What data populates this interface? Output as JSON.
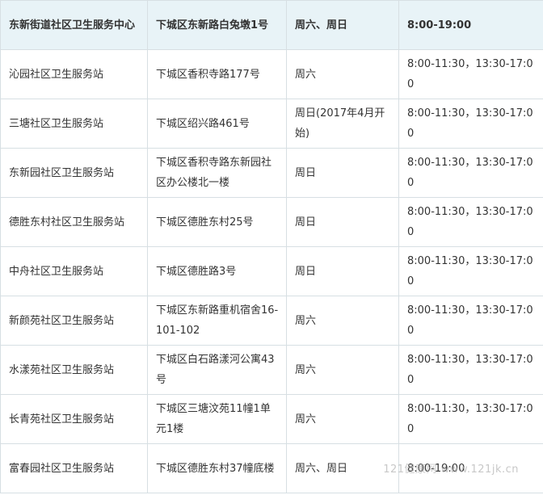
{
  "header": [
    "东新街道社区卫生服务中心",
    "下城区东新路白兔墩1号",
    "周六、周日",
    "8:00-19:00"
  ],
  "rows": [
    {
      "name": "沁园社区卫生服务站",
      "address": "下城区香积寺路177号",
      "days": "周六",
      "hours": "8:00-11:30，13:30-17:00"
    },
    {
      "name": "三塘社区卫生服务站",
      "address": "下城区绍兴路461号",
      "days": "周日(2017年4月开始)",
      "hours": "8:00-11:30，13:30-17:00"
    },
    {
      "name": "东新园社区卫生服务站",
      "address": "下城区香积寺路东新园社区办公楼北一楼",
      "days": "周日",
      "hours": "8:00-11:30，13:30-17:00"
    },
    {
      "name": "德胜东村社区卫生服务站",
      "address": "下城区德胜东村25号",
      "days": "周日",
      "hours": "8:00-11:30，13:30-17:00"
    },
    {
      "name": "中舟社区卫生服务站",
      "address": "下城区德胜路3号",
      "days": "周日",
      "hours": "8:00-11:30，13:30-17:00"
    },
    {
      "name": "新颜苑社区卫生服务站",
      "address": "下城区东新路重机宿舍16-101-102",
      "days": "周六",
      "hours": "8:00-11:30，13:30-17:00"
    },
    {
      "name": "水漾苑社区卫生服务站",
      "address": "下城区白石路漾河公寓43号",
      "days": "周六",
      "hours": "8:00-11:30，13:30-17:00"
    },
    {
      "name": "长青苑社区卫生服务站",
      "address": "下城区三塘汶苑11幢1单元1楼",
      "days": "周六",
      "hours": "8:00-11:30，13:30-17:00"
    },
    {
      "name": "富春园社区卫生服务站",
      "address": "下城区德胜东村37幢底楼",
      "days": "周六、周日",
      "hours": "8:00-19:00"
    }
  ],
  "watermark": "121健康网 www.121jk.cn"
}
